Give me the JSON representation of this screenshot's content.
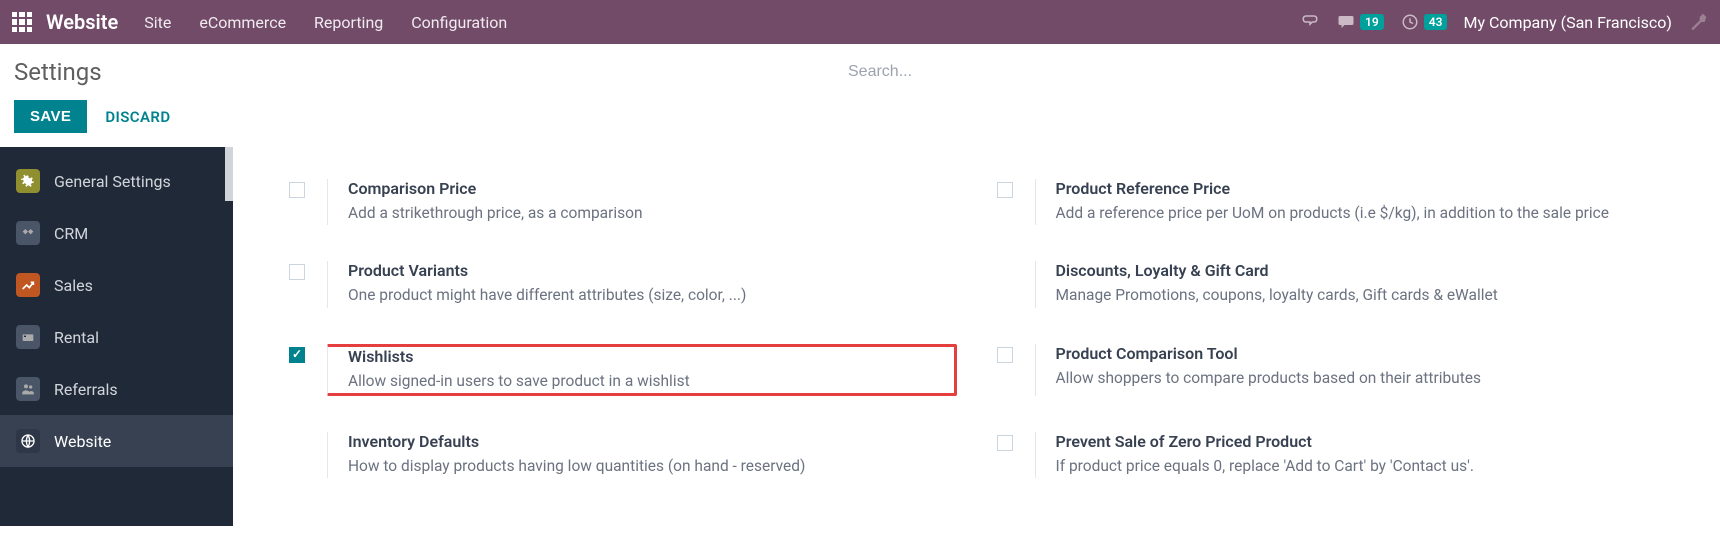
{
  "navbar": {
    "brand": "Website",
    "menu": [
      "Site",
      "eCommerce",
      "Reporting",
      "Configuration"
    ],
    "badges": {
      "chat": "19",
      "clock": "43"
    },
    "company": "My Company (San Francisco)"
  },
  "header": {
    "title": "Settings",
    "search_placeholder": "Search..."
  },
  "actions": {
    "save": "SAVE",
    "discard": "DISCARD"
  },
  "sidebar": [
    {
      "label": "General Settings"
    },
    {
      "label": "CRM"
    },
    {
      "label": "Sales"
    },
    {
      "label": "Rental"
    },
    {
      "label": "Referrals"
    },
    {
      "label": "Website"
    }
  ],
  "settings": {
    "left": [
      {
        "title": "Comparison Price",
        "desc": "Add a strikethrough price, as a comparison",
        "checked": false,
        "has_cb": true
      },
      {
        "title": "Product Variants",
        "desc": "One product might have different attributes (size, color, ...)",
        "checked": false,
        "has_cb": true
      },
      {
        "title": "Wishlists",
        "desc": "Allow signed-in users to save product in a wishlist",
        "checked": true,
        "has_cb": true,
        "hl": true
      },
      {
        "title": "Inventory Defaults",
        "desc": "How to display products having low quantities (on hand - reserved)",
        "has_cb": false
      }
    ],
    "right": [
      {
        "title": "Product Reference Price",
        "desc": "Add a reference price per UoM on products (i.e $/kg), in addition to the sale price",
        "checked": false,
        "has_cb": true
      },
      {
        "title": "Discounts, Loyalty & Gift Card",
        "desc": "Manage Promotions, coupons, loyalty cards, Gift cards & eWallet",
        "has_cb": false
      },
      {
        "title": "Product Comparison Tool",
        "desc": "Allow shoppers to compare products based on their attributes",
        "checked": false,
        "has_cb": true
      },
      {
        "title": "Prevent Sale of Zero Priced Product",
        "desc": "If product price equals 0, replace 'Add to Cart' by 'Contact us'.",
        "checked": false,
        "has_cb": true
      }
    ]
  }
}
